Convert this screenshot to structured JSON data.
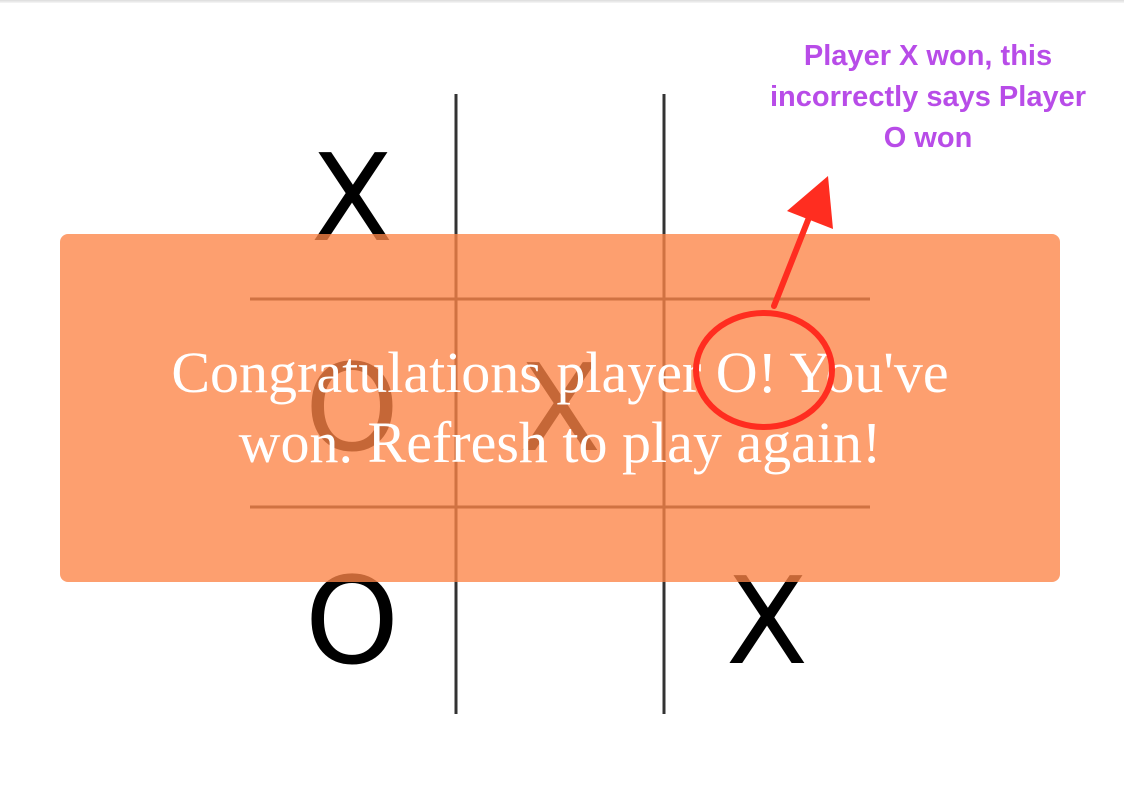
{
  "board": {
    "cells": [
      [
        "X",
        "",
        ""
      ],
      [
        "O",
        "X",
        ""
      ],
      [
        "O",
        "",
        "X"
      ]
    ]
  },
  "overlay": {
    "message": "Congratulations player O! You've won. Refresh to play again!"
  },
  "annotation": {
    "note": "Player X won, this incorrectly says Player O won",
    "color": "#b84ce8",
    "marker_color": "#ff2d20"
  },
  "colors": {
    "overlay_bg": "#fc8446",
    "overlay_text": "#ffffff",
    "grid_line": "#333333",
    "mark": "#000000"
  }
}
